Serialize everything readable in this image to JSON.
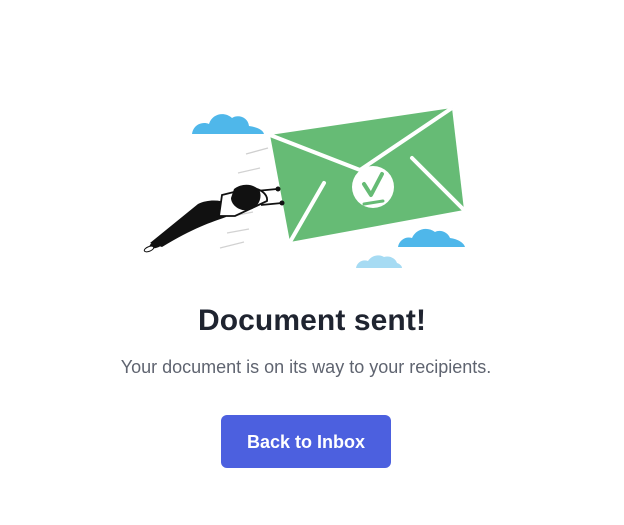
{
  "success": {
    "title": "Document sent!",
    "message": "Your document is on its way to your recipients.",
    "button_label": "Back to Inbox"
  },
  "colors": {
    "envelope_green": "#66bb75",
    "cloud_blue": "#4fb7ea",
    "light_cloud_blue": "#9fd9f3",
    "button_blue": "#4c60df",
    "title_text": "#1f2430",
    "message_text": "#5f6470"
  },
  "illustration": {
    "name": "flying-person-with-envelope",
    "icon": "checkmark-icon"
  }
}
